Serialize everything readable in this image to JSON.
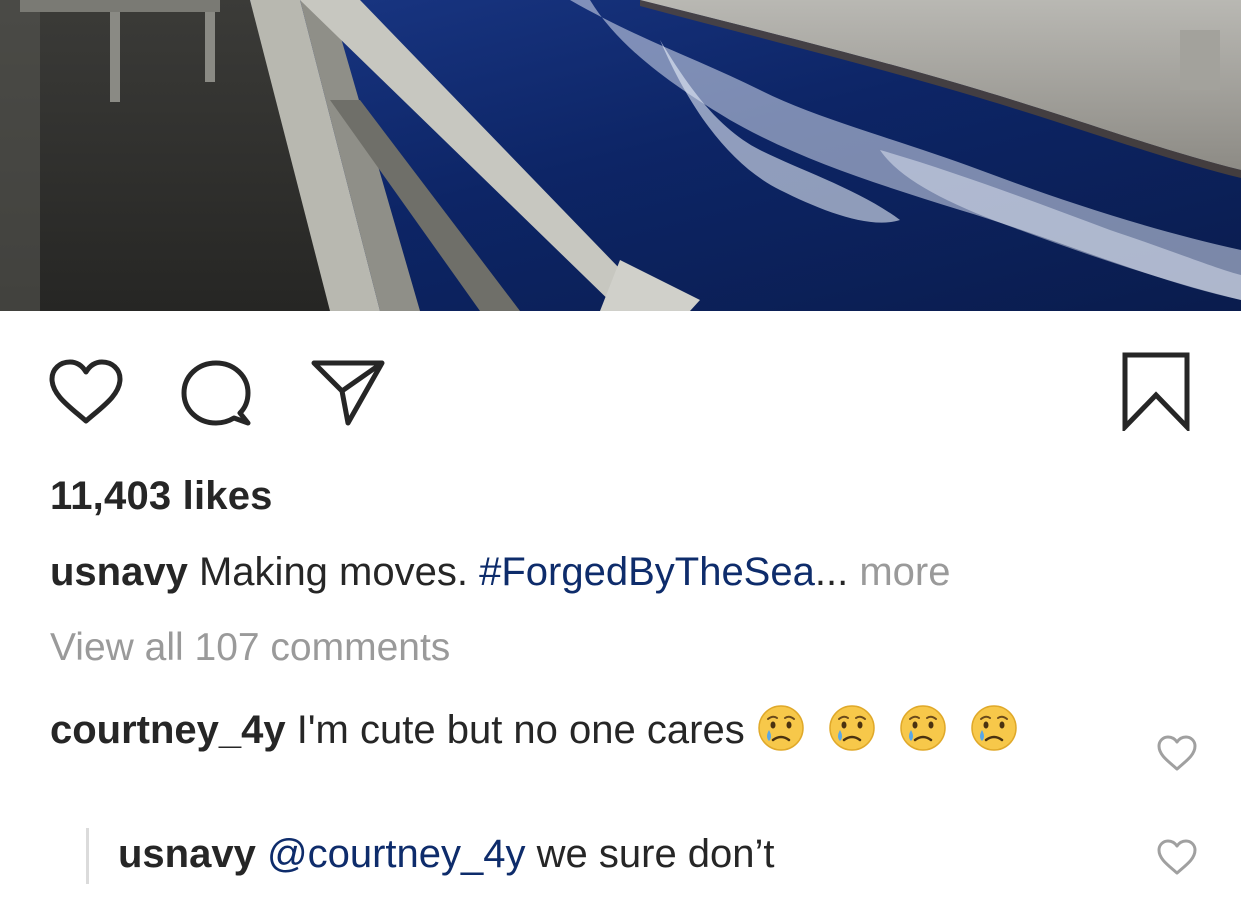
{
  "post": {
    "image_alt_icon": "ship-deck-photo",
    "likes_text": "11,403 likes",
    "caption": {
      "username": "usnavy",
      "text": "Making moves.",
      "hashtag": "#ForgedByTheSea",
      "ellipsis": "...",
      "more": "more"
    },
    "view_all": "View all 107 comments"
  },
  "actions": {
    "like_icon": "heart-icon",
    "comment_icon": "comment-icon",
    "share_icon": "paper-plane-icon",
    "save_icon": "bookmark-icon"
  },
  "comments": [
    {
      "username": "courtney_4y",
      "text": "I'm cute but no one cares",
      "emoji": "crying-face",
      "emoji_count": 4
    }
  ],
  "reply": {
    "username": "usnavy",
    "mention": "@courtney_4y",
    "text": "we sure don’t"
  },
  "colors": {
    "text": "#262626",
    "muted": "#9a9a9a",
    "link": "#0e2c6b",
    "background": "#ffffff"
  }
}
